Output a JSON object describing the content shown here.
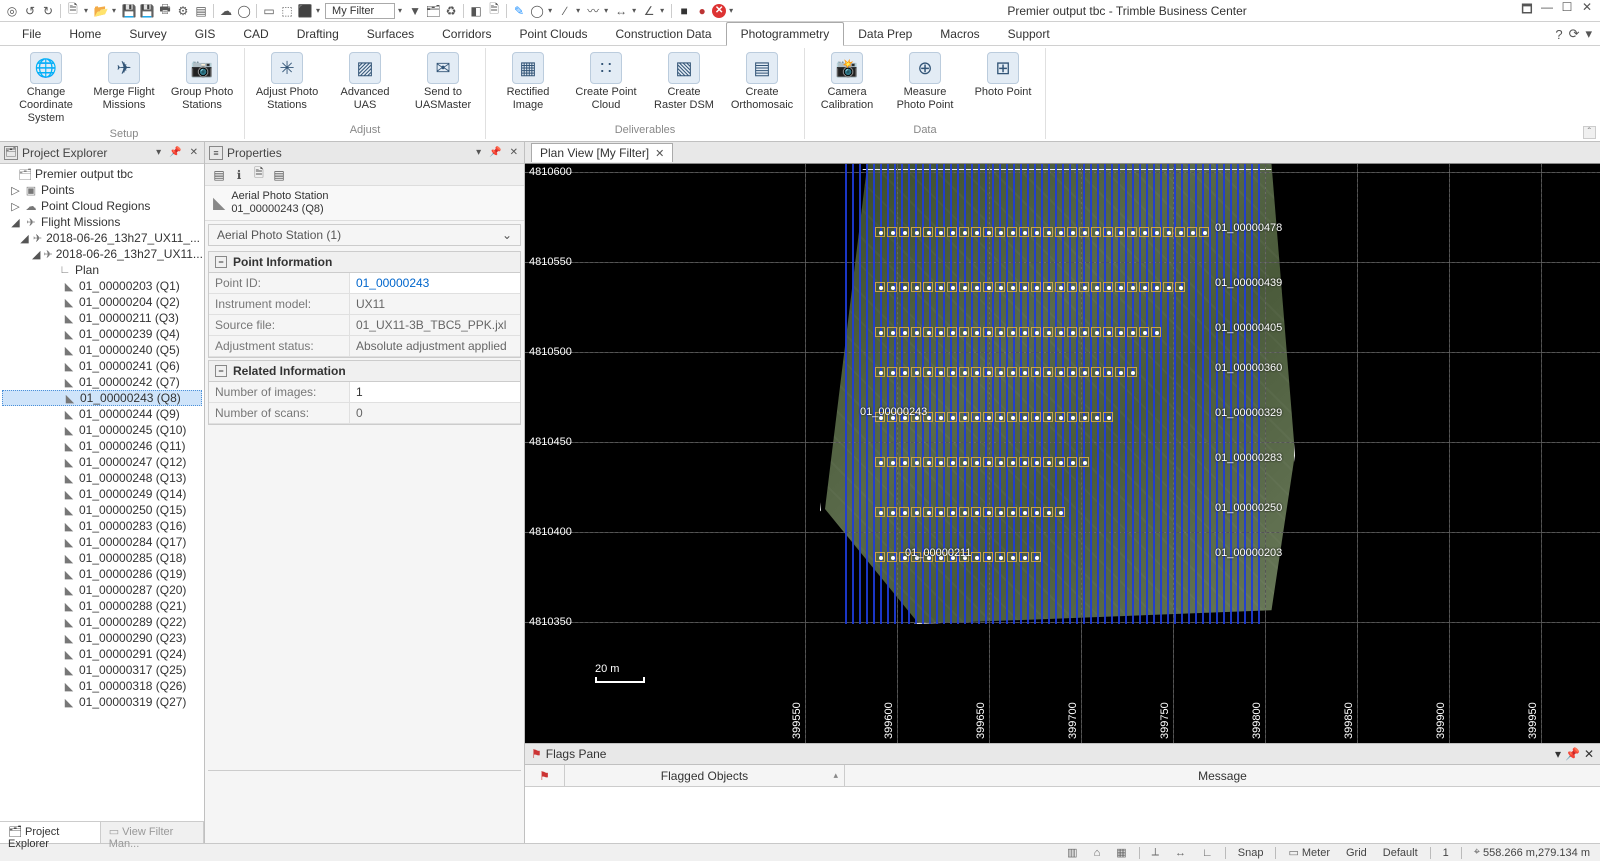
{
  "app_title": "Premier output tbc - Trimble Business Center",
  "quick_access_filter": "My Filter",
  "menu_tabs": [
    "File",
    "Home",
    "Survey",
    "GIS",
    "CAD",
    "Drafting",
    "Surfaces",
    "Corridors",
    "Point Clouds",
    "Construction Data",
    "Photogrammetry",
    "Data Prep",
    "Macros",
    "Support"
  ],
  "menu_selected_index": 10,
  "ribbon": {
    "groups": [
      {
        "label": "Setup",
        "buttons": [
          {
            "name": "change-coord-sys",
            "label": "Change Coordinate System",
            "glyph": "🌐"
          },
          {
            "name": "merge-flight",
            "label": "Merge Flight Missions",
            "glyph": "✈"
          },
          {
            "name": "group-photo",
            "label": "Group Photo Stations",
            "glyph": "📷"
          }
        ]
      },
      {
        "label": "Adjust",
        "buttons": [
          {
            "name": "adjust-photo",
            "label": "Adjust Photo Stations",
            "glyph": "✳"
          },
          {
            "name": "advanced-uas",
            "label": "Advanced UAS",
            "glyph": "▨"
          },
          {
            "name": "send-uasmaster",
            "label": "Send to UASMaster",
            "glyph": "✉"
          }
        ]
      },
      {
        "label": "Deliverables",
        "buttons": [
          {
            "name": "rectified-image",
            "label": "Rectified Image",
            "glyph": "▦"
          },
          {
            "name": "create-point-cloud",
            "label": "Create Point Cloud",
            "glyph": "∷"
          },
          {
            "name": "create-raster-dsm",
            "label": "Create Raster DSM",
            "glyph": "▧"
          },
          {
            "name": "create-orthomosaic",
            "label": "Create Orthomosaic",
            "glyph": "▤"
          }
        ]
      },
      {
        "label": "Data",
        "buttons": [
          {
            "name": "camera-calibration",
            "label": "Camera Calibration",
            "glyph": "📸"
          },
          {
            "name": "measure-photo-point",
            "label": "Measure Photo Point",
            "glyph": "⊕"
          },
          {
            "name": "photo-point",
            "label": "Photo Point",
            "glyph": "⊞"
          }
        ]
      }
    ]
  },
  "left_pane": {
    "title": "Project Explorer",
    "root": "Premier output tbc",
    "top_nodes": [
      {
        "label": "Points",
        "glyph": "▣",
        "exp": "▷"
      },
      {
        "label": "Point Cloud Regions",
        "glyph": "☁",
        "exp": "▷"
      },
      {
        "label": "Flight Missions",
        "glyph": "✈",
        "exp": "◢"
      }
    ],
    "mission_level1": "2018-06-26_13h27_UX11_...",
    "mission_level2": "2018-06-26_13h27_UX11...",
    "plan_label": "Plan",
    "stations": [
      "01_00000203 (Q1)",
      "01_00000204 (Q2)",
      "01_00000211 (Q3)",
      "01_00000239 (Q4)",
      "01_00000240 (Q5)",
      "01_00000241 (Q6)",
      "01_00000242 (Q7)",
      "01_00000243 (Q8)",
      "01_00000244 (Q9)",
      "01_00000245 (Q10)",
      "01_00000246 (Q11)",
      "01_00000247 (Q12)",
      "01_00000248 (Q13)",
      "01_00000249 (Q14)",
      "01_00000250 (Q15)",
      "01_00000283 (Q16)",
      "01_00000284 (Q17)",
      "01_00000285 (Q18)",
      "01_00000286 (Q19)",
      "01_00000287 (Q20)",
      "01_00000288 (Q21)",
      "01_00000289 (Q22)",
      "01_00000290 (Q23)",
      "01_00000291 (Q24)",
      "01_00000317 (Q25)",
      "01_00000318 (Q26)",
      "01_00000319 (Q27)"
    ],
    "selected_station_index": 7,
    "bottom_tabs": {
      "active": "Project Explorer",
      "other": "View Filter Man..."
    }
  },
  "properties": {
    "title": "Properties",
    "object_type": "Aerial Photo Station",
    "object_name": "01_00000243 (Q8)",
    "type_row": "Aerial Photo Station (1)",
    "sections": [
      {
        "title": "Point Information",
        "rows": [
          {
            "k": "Point ID:",
            "v": "01_00000243",
            "link": true
          },
          {
            "k": "Instrument model:",
            "v": "UX11",
            "dim": true
          },
          {
            "k": "Source file:",
            "v": "01_UX11-3B_TBC5_PPK.jxl",
            "dim": true
          },
          {
            "k": "Adjustment status:",
            "v": "Absolute adjustment applied",
            "dim": true
          }
        ]
      },
      {
        "title": "Related Information",
        "rows": [
          {
            "k": "Number of images:",
            "v": "1"
          },
          {
            "k": "Number of scans:",
            "v": "0",
            "dim": true
          }
        ]
      }
    ]
  },
  "planview": {
    "tab_label": "Plan View [My Filter]",
    "y_ticks": [
      "4810600",
      "4810550",
      "4810500",
      "4810450",
      "4810400",
      "4810350"
    ],
    "x_ticks": [
      "399550",
      "399600",
      "399650",
      "399700",
      "399750",
      "399800",
      "399850",
      "399900",
      "399950"
    ],
    "scale_label": "20 m",
    "row_ids_left": [
      "01_00000243"
    ],
    "row_ids_right": [
      "01_00000478",
      "01_00000439",
      "01_00000405",
      "01_00000360",
      "01_00000329",
      "01_00000283",
      "01_00000250",
      "01_00000203"
    ],
    "row_extra_left": "01_00000211"
  },
  "flags": {
    "title": "Flags Pane",
    "col1": "⚑",
    "col2": "Flagged Objects",
    "col3": "Message"
  },
  "status": {
    "snap": "Snap",
    "units": "Meter",
    "grid": "Grid",
    "mode": "Default",
    "sel_count": "1",
    "coords": "558.266 m,279.134 m"
  }
}
